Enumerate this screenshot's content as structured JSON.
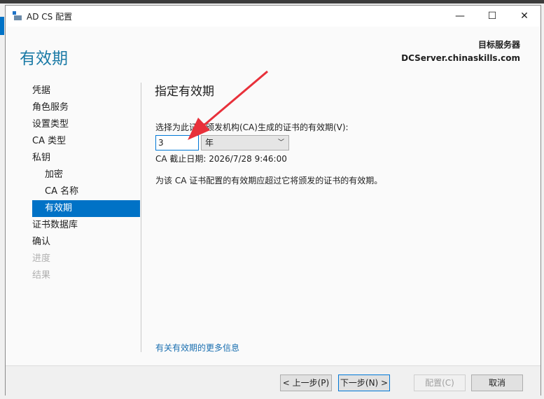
{
  "window": {
    "title": "AD CS 配置",
    "minimize": "—",
    "maximize": "☐",
    "close": "✕"
  },
  "header": {
    "title": "有效期",
    "target_label": "目标服务器",
    "target_server": "DCServer.chinaskills.com"
  },
  "nav": [
    {
      "label": "凭据",
      "state": "normal"
    },
    {
      "label": "角色服务",
      "state": "normal"
    },
    {
      "label": "设置类型",
      "state": "normal"
    },
    {
      "label": "CA 类型",
      "state": "normal"
    },
    {
      "label": "私钥",
      "state": "normal"
    },
    {
      "label": "加密",
      "state": "sub"
    },
    {
      "label": "CA 名称",
      "state": "sub"
    },
    {
      "label": "有效期",
      "state": "selected"
    },
    {
      "label": "证书数据库",
      "state": "normal"
    },
    {
      "label": "确认",
      "state": "normal"
    },
    {
      "label": "进度",
      "state": "disabled"
    },
    {
      "label": "结果",
      "state": "disabled"
    }
  ],
  "main": {
    "heading": "指定有效期",
    "validity_label": "选择为此证书颁发机构(CA)生成的证书的有效期(V):",
    "validity_value": "3",
    "unit_selected": "年",
    "expiry": "CA 截止日期: 2026/7/28 9:46:00",
    "note": "为该 CA 证书配置的有效期应超过它将颁发的证书的有效期。",
    "more_info_link": "有关有效期的更多信息"
  },
  "footer": {
    "back": "< 上一步(P)",
    "next": "下一步(N) >",
    "configure": "配置(C)",
    "cancel": "取消"
  },
  "colors": {
    "accent": "#0072c6",
    "annotation_arrow": "#e8303a"
  }
}
